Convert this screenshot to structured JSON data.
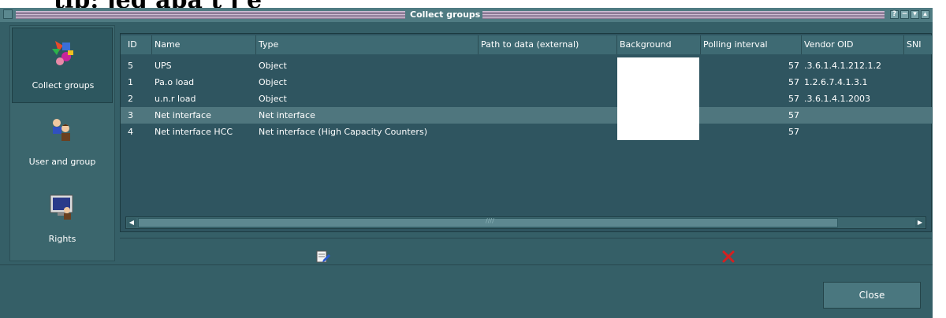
{
  "page": {
    "heading": "tip: jeg apa t j e"
  },
  "window": {
    "title": "Collect groups",
    "buttons": [
      "?",
      "−",
      "▾",
      "▴"
    ]
  },
  "sidebar": {
    "items": [
      {
        "label": "Collect groups",
        "icon": "collect-groups-icon",
        "active": true
      },
      {
        "label": "User and group",
        "icon": "users-icon",
        "active": false
      },
      {
        "label": "Rights",
        "icon": "monitor-rights-icon",
        "active": false
      }
    ]
  },
  "table": {
    "columns": [
      "ID",
      "Name",
      "Type",
      "Path to data (external)",
      "Background",
      "Polling interval",
      "Vendor OID",
      "SNI"
    ],
    "rows": [
      {
        "id": "5",
        "name": "UPS",
        "type": "Object",
        "path": "",
        "background": "#ffffff",
        "polling": "57",
        "vendor_oid": ".3.6.1.4.1.212.1.2",
        "selected": false
      },
      {
        "id": "1",
        "name": "Pa.o load",
        "type": "Object",
        "path": "",
        "background": "#ffffff",
        "polling": "57",
        "vendor_oid": "1.2.6.7.4.1.3.1",
        "selected": false
      },
      {
        "id": "2",
        "name": "u.n.r load",
        "type": "Object",
        "path": "",
        "background": "#ffffff",
        "polling": "57",
        "vendor_oid": ".3.6.1.4.1.2003",
        "selected": false
      },
      {
        "id": "3",
        "name": "Net interface",
        "type": "Net interface",
        "path": "",
        "background": "#ffffff",
        "polling": "57",
        "vendor_oid": "",
        "selected": true
      },
      {
        "id": "4",
        "name": "Net interface HCC",
        "type": "Net interface (High Capacity Counters)",
        "path": "",
        "background": "#ffffff",
        "polling": "57",
        "vendor_oid": "",
        "selected": false
      }
    ]
  },
  "scrollbar": {
    "left_arrow": "◀",
    "right_arrow": "▶",
    "thumb_grip": "////"
  },
  "actions": {
    "edit_icon": "edit-icon",
    "delete_icon": "delete-icon"
  },
  "footer": {
    "close_label": "Close"
  },
  "colors": {
    "window_bg": "#355f67",
    "selected_row": "#4f767e",
    "delete_red": "#d42020"
  }
}
